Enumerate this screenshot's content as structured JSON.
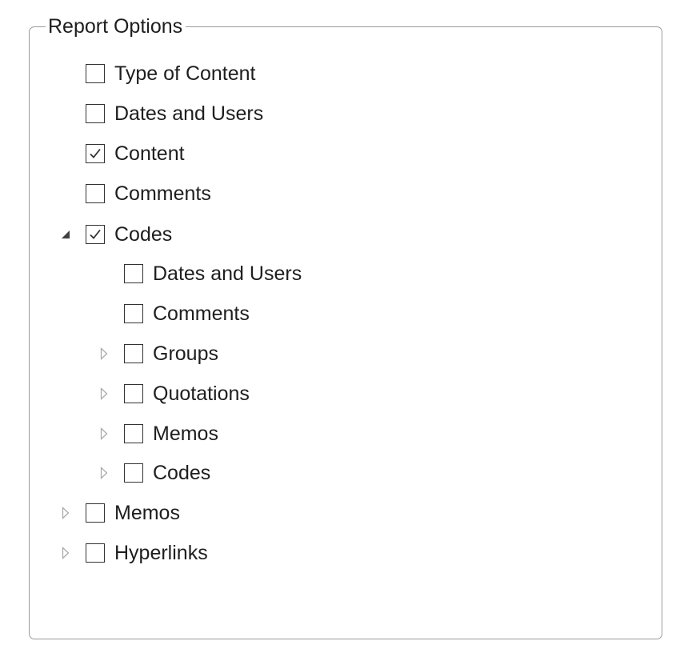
{
  "report_options": {
    "title": "Report Options",
    "items": [
      {
        "label": "Type of Content",
        "checked": false,
        "expander": "none"
      },
      {
        "label": "Dates and Users",
        "checked": false,
        "expander": "none"
      },
      {
        "label": "Content",
        "checked": true,
        "expander": "none"
      },
      {
        "label": "Comments",
        "checked": false,
        "expander": "none"
      },
      {
        "label": "Codes",
        "checked": true,
        "expander": "expanded",
        "children": [
          {
            "label": "Dates and Users",
            "checked": false,
            "expander": "none"
          },
          {
            "label": "Comments",
            "checked": false,
            "expander": "none"
          },
          {
            "label": "Groups",
            "checked": false,
            "expander": "collapsed"
          },
          {
            "label": "Quotations",
            "checked": false,
            "expander": "collapsed"
          },
          {
            "label": "Memos",
            "checked": false,
            "expander": "collapsed"
          },
          {
            "label": "Codes",
            "checked": false,
            "expander": "collapsed"
          }
        ]
      },
      {
        "label": "Memos",
        "checked": false,
        "expander": "collapsed"
      },
      {
        "label": "Hyperlinks",
        "checked": false,
        "expander": "collapsed"
      }
    ]
  },
  "icons": {
    "expanded": "triangle-expanded-icon",
    "collapsed": "triangle-collapsed-icon",
    "check": "checkmark-icon"
  },
  "colors": {
    "border": "#9a9a9a",
    "checkbox_border": "#333333",
    "text": "#1e1e1e",
    "expander_filled": "#404040",
    "expander_outline": "#a6a6a6"
  }
}
